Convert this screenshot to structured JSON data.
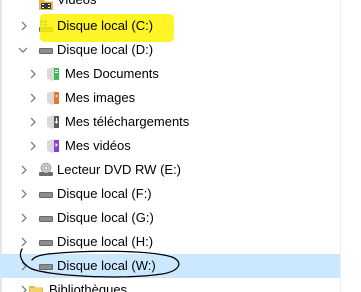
{
  "tree": {
    "items": [
      {
        "label": "Vidéos",
        "icon": "videos-folder-icon",
        "expanded": false
      },
      {
        "label": "Disque local (C:)",
        "icon": "windows-drive-icon",
        "expanded": false
      },
      {
        "label": "Disque local (D:)",
        "icon": "drive-icon",
        "expanded": true
      },
      {
        "label": "Mes Documents",
        "icon": "documents-folder-icon",
        "expanded": false
      },
      {
        "label": "Mes images",
        "icon": "pictures-folder-icon",
        "expanded": false
      },
      {
        "label": "Mes téléchargements",
        "icon": "downloads-folder-icon",
        "expanded": false
      },
      {
        "label": "Mes vidéos",
        "icon": "videos-folder-icon",
        "expanded": false
      },
      {
        "label": "Lecteur DVD RW (E:)",
        "icon": "dvd-drive-icon",
        "expanded": false
      },
      {
        "label": "Disque local (F:)",
        "icon": "drive-icon",
        "expanded": false
      },
      {
        "label": "Disque local (G:)",
        "icon": "drive-icon",
        "expanded": false
      },
      {
        "label": "Disque local (H:)",
        "icon": "drive-icon",
        "expanded": false
      },
      {
        "label": "Disque local (W:)",
        "icon": "drive-icon",
        "expanded": false,
        "selected": true
      },
      {
        "label": "Bibliothèques",
        "icon": "libraries-folder-icon",
        "expanded": false
      }
    ]
  },
  "annotations": {
    "highlight_color": "#fff200",
    "outline_color": "#000000",
    "highlighted_item": "Disque local (C:)",
    "circled_item": "Disque local (W:)"
  },
  "colors": {
    "selection": "#cce8ff",
    "chevron": "#6e6e6e"
  }
}
